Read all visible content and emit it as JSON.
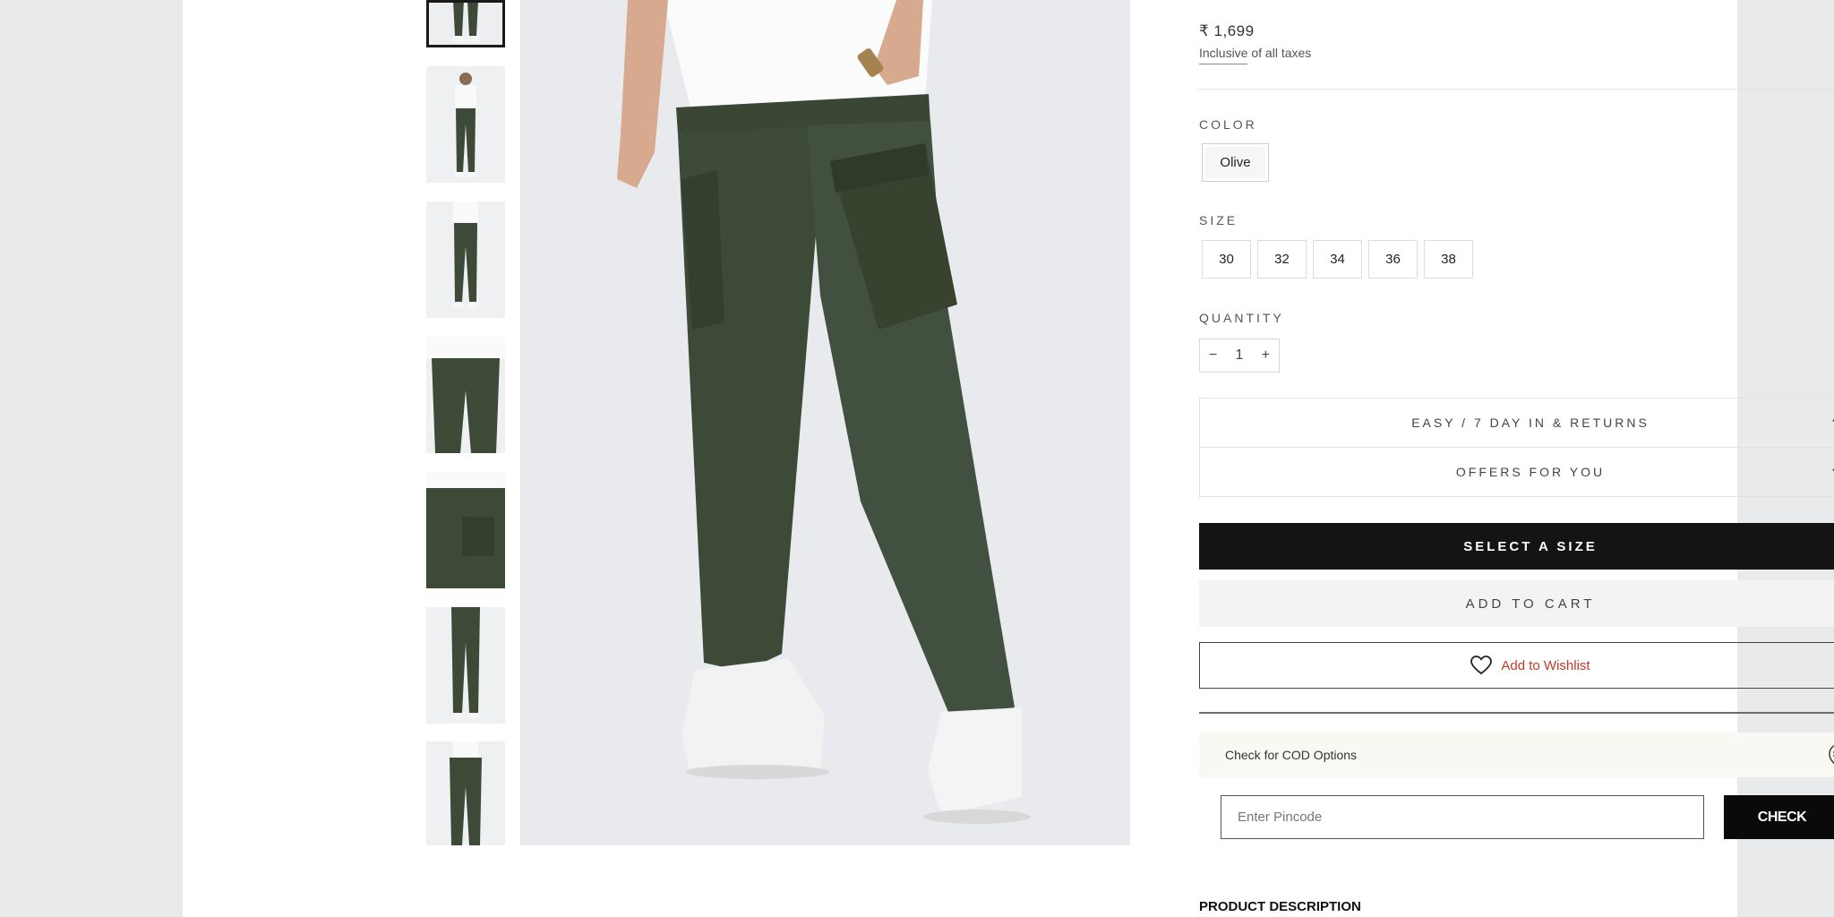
{
  "product": {
    "price": "₹ 1,699",
    "tax_note": "Inclusive of all taxes"
  },
  "color": {
    "label": "COLOR",
    "selected": "Olive"
  },
  "size": {
    "label": "SIZE",
    "options": [
      "30",
      "32",
      "34",
      "36",
      "38"
    ]
  },
  "quantity": {
    "label": "QUANTITY",
    "minus": "−",
    "value": "1",
    "plus": "+"
  },
  "accordions": [
    {
      "label": "EASY / 7 DAY IN & RETURNS",
      "icon": "chevron-down-icon"
    },
    {
      "label": "OFFERS FOR YOU",
      "icon": "chevron-down-icon"
    }
  ],
  "actions": {
    "select_size": "SELECT A SIZE",
    "add_to_cart": "ADD TO CART",
    "wishlist": "Add to Wishlist"
  },
  "delivery": {
    "cod_text": "Check for COD Options",
    "pincode_placeholder": "Enter Pincode",
    "check_label": "CHECK"
  },
  "description": {
    "title": "PRODUCT DESCRIPTION"
  },
  "colors": {
    "accent_black": "#141414",
    "wishlist_text": "#c0392b",
    "product_olive": "#3d4a38"
  }
}
